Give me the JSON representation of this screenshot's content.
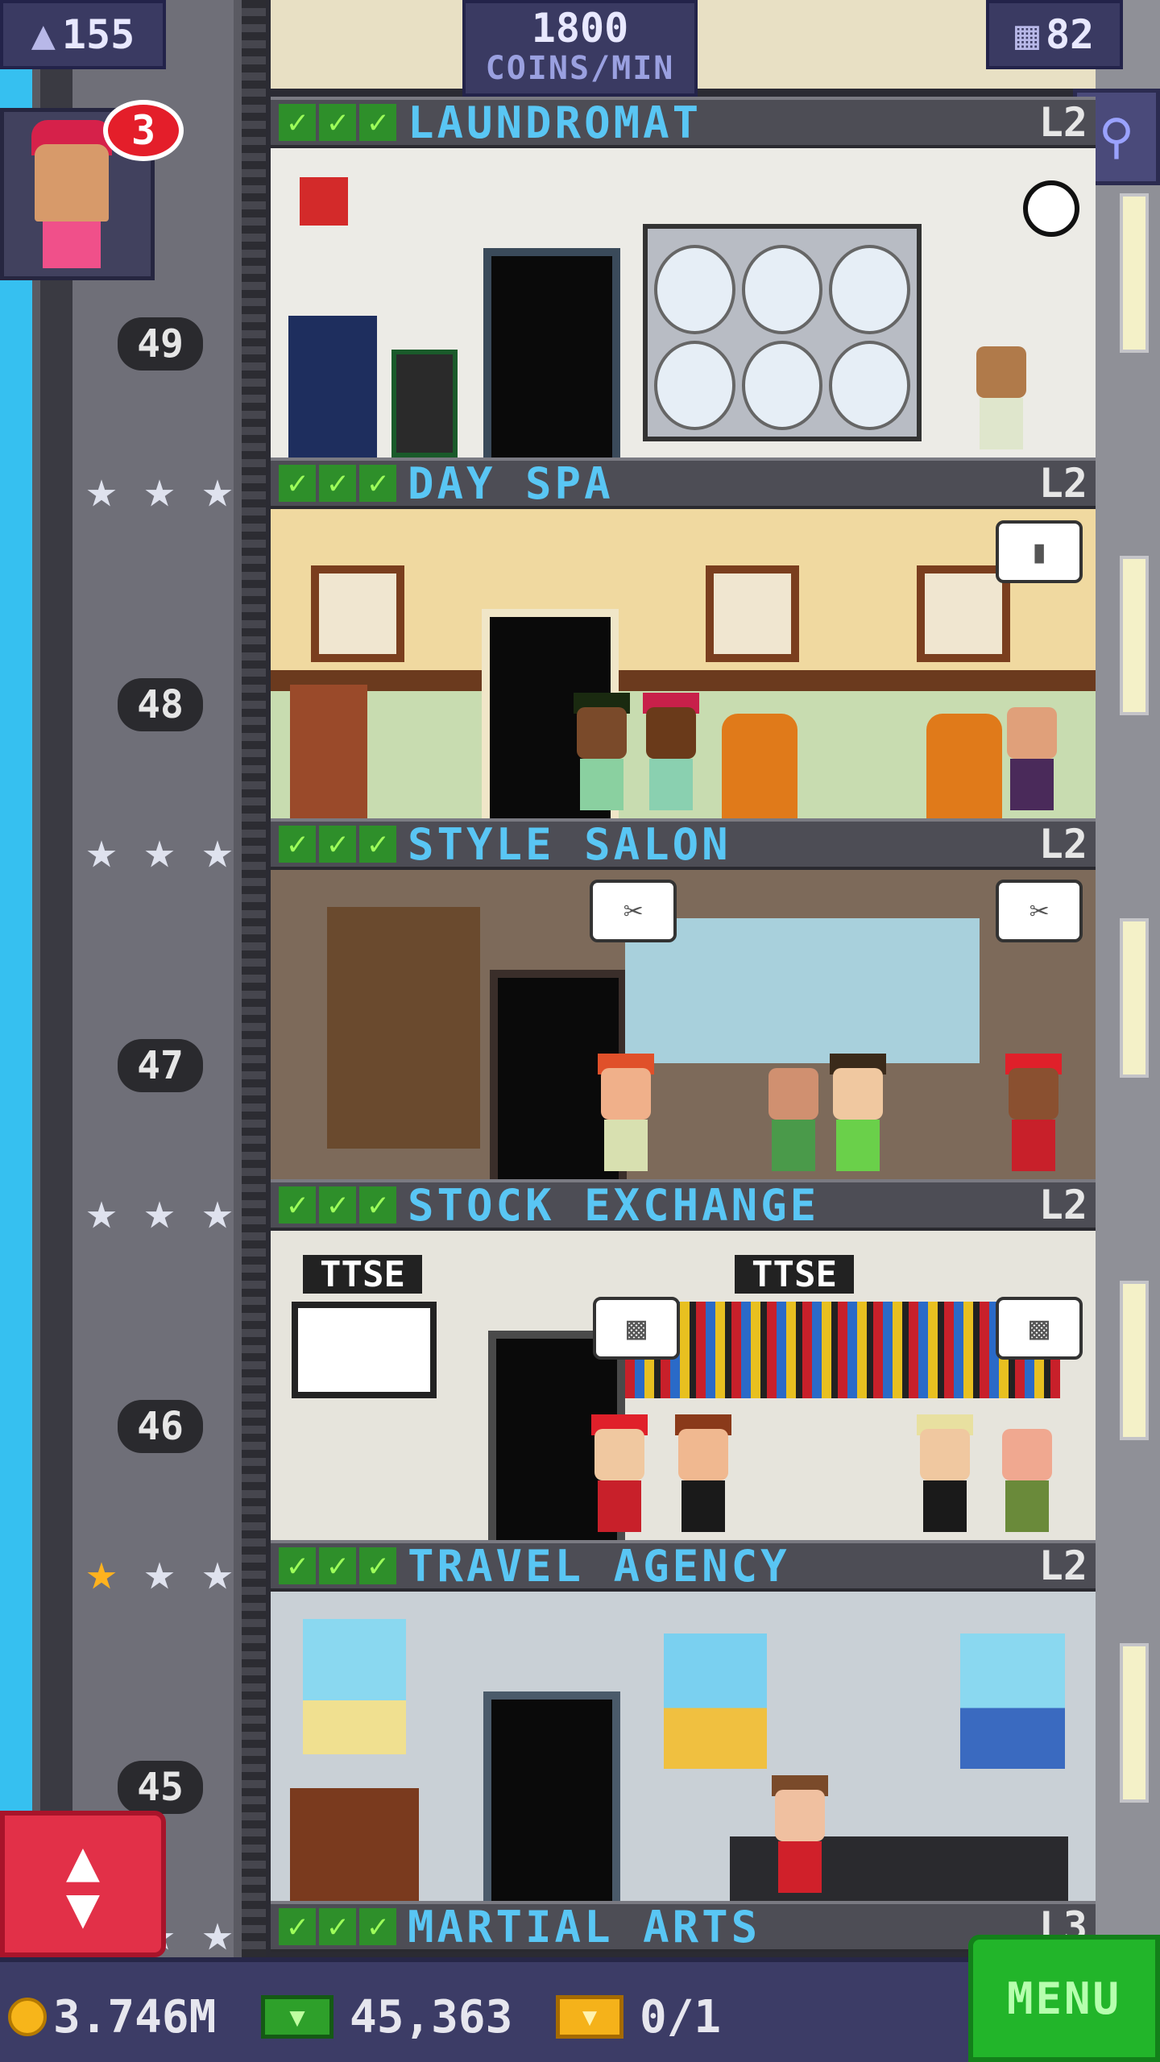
{
  "top_bar": {
    "population": "155",
    "rate_value": "1800",
    "rate_unit": "COINS/MIN",
    "floors": "82"
  },
  "notifications": {
    "count": "3"
  },
  "floors": [
    {
      "name": "LAUNDROMAT",
      "level": "L2",
      "number": "49",
      "bg": "#ecebe6"
    },
    {
      "name": "DAY SPA",
      "level": "L2",
      "number": "48",
      "bg": "#f0d9a0"
    },
    {
      "name": "STYLE SALON",
      "level": "L2",
      "number": "47",
      "bg": "#7d6a5a"
    },
    {
      "name": "STOCK EXCHANGE",
      "level": "L2",
      "number": "46",
      "bg": "#e6e4dc"
    },
    {
      "name": "TRAVEL AGENCY",
      "level": "L2",
      "number": "45",
      "bg": "#c9d0d6"
    },
    {
      "name": "MARTIAL ARTS",
      "level": "L3"
    }
  ],
  "room_labels": {
    "exchange_sign_left": "TTSE",
    "exchange_sign_right": "TTSE"
  },
  "bottom_bar": {
    "coins": "3.746M",
    "bux": "45,363",
    "tickets": "0/1",
    "menu_label": "MENU"
  },
  "colors": {
    "accent_blue": "#59c6f4",
    "menu_green": "#22b52a",
    "elevator_red": "#e23048"
  }
}
